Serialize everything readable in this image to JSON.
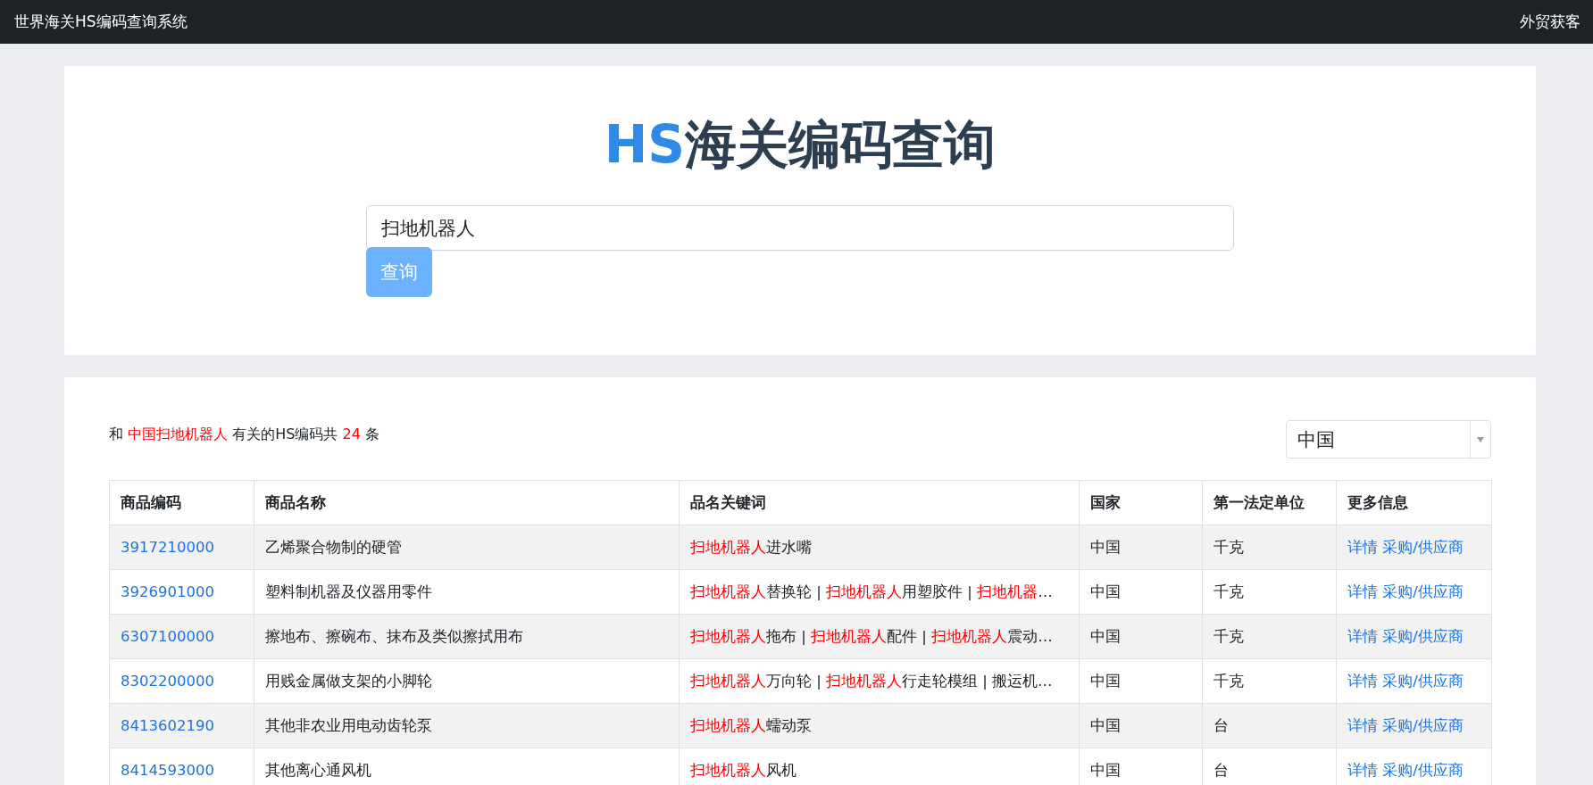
{
  "navbar": {
    "brand": "世界海关HS编码查询系统",
    "right_link": "外贸获客"
  },
  "search_panel": {
    "title_prefix": "HS",
    "title_rest": "海关编码查询",
    "query": "扫地机器人",
    "button": "查询"
  },
  "results": {
    "summary": [
      {
        "text": "和 ",
        "highlight": false
      },
      {
        "text": "中国扫地机器人",
        "highlight": true
      },
      {
        "text": " 有关的HS编码共 ",
        "highlight": false
      },
      {
        "text": "24",
        "highlight": true
      },
      {
        "text": " 条",
        "highlight": false
      }
    ],
    "country_select": "中国",
    "table": {
      "columns": [
        "商品编码",
        "商品名称",
        "品名关键词",
        "国家",
        "第一法定单位",
        "更多信息"
      ],
      "rows": [
        {
          "code": "3917210000",
          "name": "乙烯聚合物制的硬管",
          "keywords": [
            {
              "text": "扫地机器人",
              "highlight": true
            },
            {
              "text": "进水嘴",
              "highlight": false
            }
          ],
          "country": "中国",
          "unit": "千克",
          "links": [
            "详情",
            "采购/供应商"
          ]
        },
        {
          "code": "3926901000",
          "name": "塑料制机器及仪器用零件",
          "keywords": [
            {
              "text": "扫地机器人",
              "highlight": true
            },
            {
              "text": "替换轮 | ",
              "highlight": false
            },
            {
              "text": "扫地机器人",
              "highlight": true
            },
            {
              "text": "用塑胶件 | ",
              "highlight": false
            },
            {
              "text": "扫地机器",
              "highlight": true
            },
            {
              "text": "…",
              "highlight": false
            }
          ],
          "country": "中国",
          "unit": "千克",
          "links": [
            "详情",
            "采购/供应商"
          ]
        },
        {
          "code": "6307100000",
          "name": "擦地布、擦碗布、抹布及类似擦拭用布",
          "keywords": [
            {
              "text": "扫地机器人",
              "highlight": true
            },
            {
              "text": "拖布 | ",
              "highlight": false
            },
            {
              "text": "扫地机器人",
              "highlight": true
            },
            {
              "text": "配件 | ",
              "highlight": false
            },
            {
              "text": "扫地机器人",
              "highlight": true
            },
            {
              "text": "震动…",
              "highlight": false
            }
          ],
          "country": "中国",
          "unit": "千克",
          "links": [
            "详情",
            "采购/供应商"
          ]
        },
        {
          "code": "8302200000",
          "name": "用贱金属做支架的小脚轮",
          "keywords": [
            {
              "text": "扫地机器人",
              "highlight": true
            },
            {
              "text": "万向轮 | ",
              "highlight": false
            },
            {
              "text": "扫地机器人",
              "highlight": true
            },
            {
              "text": "行走轮模组 | 搬运机…",
              "highlight": false
            }
          ],
          "country": "中国",
          "unit": "千克",
          "links": [
            "详情",
            "采购/供应商"
          ]
        },
        {
          "code": "8413602190",
          "name": "其他非农业用电动齿轮泵",
          "keywords": [
            {
              "text": "扫地机器人",
              "highlight": true
            },
            {
              "text": "蠕动泵",
              "highlight": false
            }
          ],
          "country": "中国",
          "unit": "台",
          "links": [
            "详情",
            "采购/供应商"
          ]
        },
        {
          "code": "8414593000",
          "name": "其他离心通风机",
          "keywords": [
            {
              "text": "扫地机器人",
              "highlight": true
            },
            {
              "text": "风机",
              "highlight": false
            }
          ],
          "country": "中国",
          "unit": "台",
          "links": [
            "详情",
            "采购/供应商"
          ]
        }
      ]
    }
  }
}
